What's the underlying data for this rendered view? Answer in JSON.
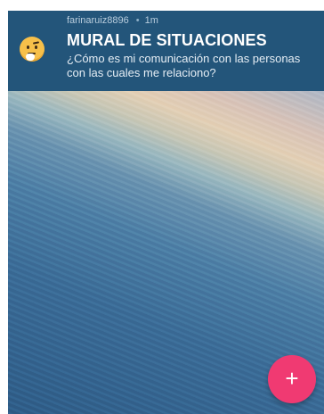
{
  "post": {
    "author": "farinaruiz8896",
    "separator": "•",
    "time": "1m",
    "title": "MURAL DE SITUACIONES",
    "subtitle": "¿Cómo es mi comunicación con las personas con las cuales me relaciono?",
    "emoji_icon": "thinking-face-icon"
  },
  "fab": {
    "icon": "plus-icon",
    "label": "+"
  },
  "colors": {
    "header_bg": "#23557a",
    "fab_bg": "#f03a72",
    "meta_text": "#b9cddd"
  }
}
